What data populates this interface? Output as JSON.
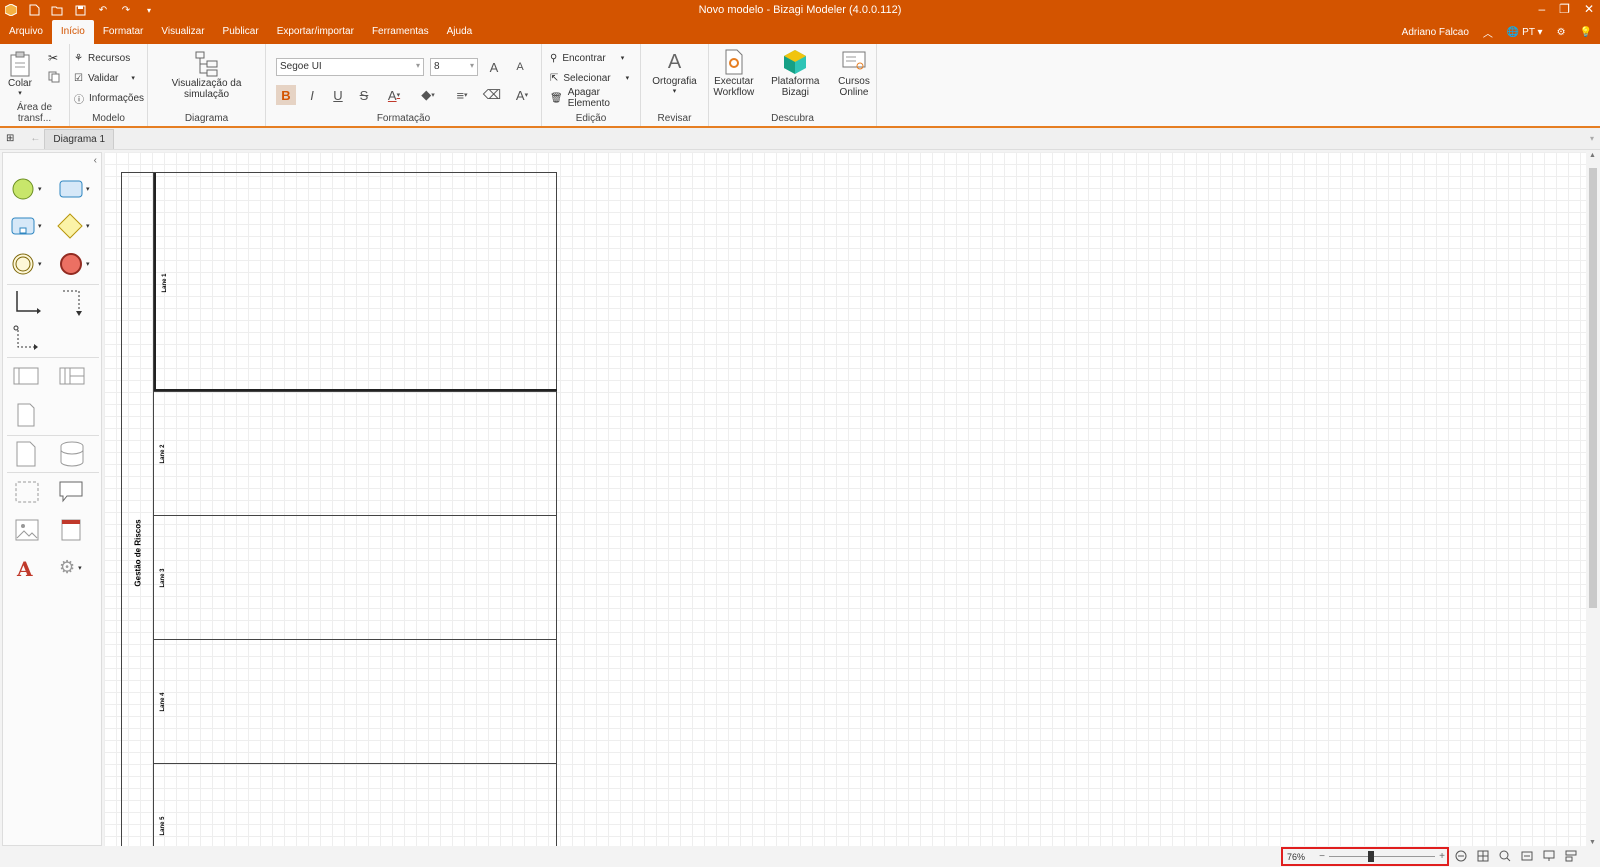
{
  "window": {
    "title": "Novo modelo - Bizagi Modeler (4.0.0.112)",
    "controls": [
      "–",
      "❐",
      "✕"
    ]
  },
  "menu": {
    "items": [
      "Arquivo",
      "Início",
      "Formatar",
      "Visualizar",
      "Publicar",
      "Exportar/importar",
      "Ferramentas",
      "Ajuda"
    ],
    "active": "Início",
    "user": "Adriano Falcao",
    "language": "PT"
  },
  "ribbon": {
    "clipboard": {
      "paste": "Colar",
      "label": "Área de transf..."
    },
    "model": {
      "resources": "Recursos",
      "validate": "Validar",
      "info": "Informações",
      "label": "Modelo"
    },
    "diagram": {
      "simulation": "Visualização da simulação",
      "label": "Diagrama"
    },
    "formatting": {
      "font": "Segoe UI",
      "size": "8",
      "label": "Formatação"
    },
    "editing": {
      "find": "Encontrar",
      "select": "Selecionar",
      "delete": "Apagar Elemento",
      "label": "Edição"
    },
    "review": {
      "spelling": "Ortografia",
      "label": "Revisar"
    },
    "discover": {
      "workflow": "Executar Workflow",
      "platform": "Plataforma Bizagi",
      "courses": "Cursos Online",
      "label": "Descubra"
    }
  },
  "tabs": {
    "diagram": "Diagrama 1"
  },
  "diagram": {
    "pool": "Gestão de Riscos",
    "lanes": [
      "Lane 1",
      "Lane 2",
      "Lane 3",
      "Lane 4",
      "Lane 5"
    ]
  },
  "status": {
    "zoom": "76%",
    "zoom_fraction": 0.39
  },
  "colors": {
    "accent": "#d35400",
    "highlight": "#e01e1e"
  }
}
